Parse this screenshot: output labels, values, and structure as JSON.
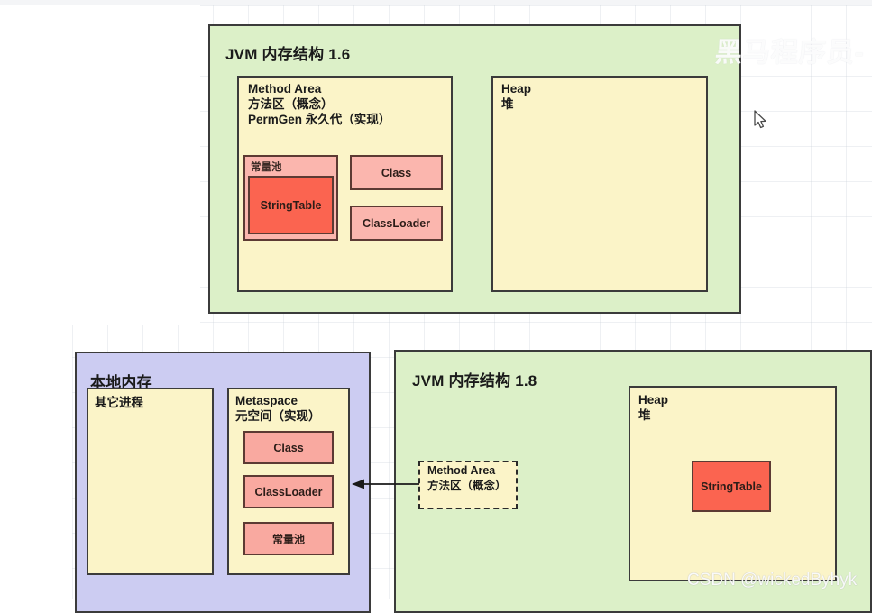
{
  "diagram": {
    "watermarks": {
      "brand": "黑马程序员-",
      "source": "CSDN @wickedByhyk"
    },
    "jvm16": {
      "title": "JVM 内存结构 1.6",
      "method_area": {
        "line1": "Method Area",
        "line2": "方法区（概念）",
        "line3": "PermGen 永久代（实现）",
        "constant_pool": {
          "label": "常量池",
          "string_table": "StringTable"
        },
        "items": [
          {
            "label": "Class"
          },
          {
            "label": "ClassLoader"
          }
        ]
      },
      "heap": {
        "line1": "Heap",
        "line2": "堆"
      }
    },
    "native_memory": {
      "title": "本地内存",
      "other_processes": {
        "label": "其它进程"
      },
      "metaspace": {
        "line1": "Metaspace",
        "line2": "元空间（实现）",
        "items": [
          {
            "label": "Class"
          },
          {
            "label": "ClassLoader"
          },
          {
            "label": "常量池"
          }
        ]
      }
    },
    "jvm18": {
      "title": "JVM 内存结构 1.8",
      "method_area_note": {
        "line1": "Method Area",
        "line2": "方法区（概念）"
      },
      "heap": {
        "line1": "Heap",
        "line2": "堆",
        "string_table": "StringTable"
      }
    },
    "colors": {
      "green": "#dcf0c8",
      "yellow": "#fbf4c8",
      "purple": "#ccccf2",
      "salmon": "#f9a9a0",
      "salmon_light": "#fbb6ae",
      "red": "#fb6450",
      "stroke": "#333333"
    }
  }
}
